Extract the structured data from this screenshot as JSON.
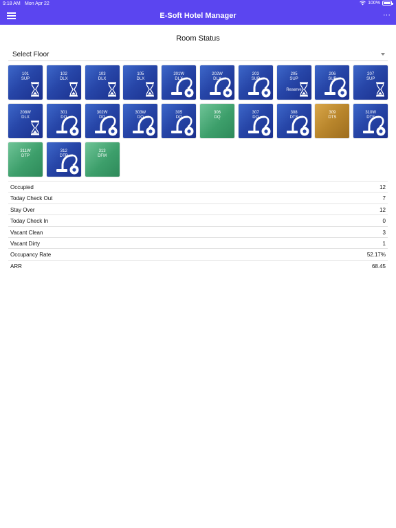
{
  "status_bar": {
    "time": "9:18 AM",
    "date": "Mon Apr 22",
    "battery": "100%"
  },
  "header": {
    "title": "E-Soft Hotel Manager",
    "more": "···"
  },
  "page": {
    "title": "Room Status",
    "floor_select_label": "Select Floor"
  },
  "colors": {
    "header": "#5b45f0",
    "occupied": "#2746a8",
    "vacant_clean": "#3d9f6b",
    "reserved": "#b9862c"
  },
  "rooms": [
    {
      "num": "101",
      "type": "SUP",
      "color": "blue",
      "icon": "hourglass-icon",
      "note": ""
    },
    {
      "num": "102",
      "type": "DLX",
      "color": "blue",
      "icon": "hourglass-icon",
      "note": ""
    },
    {
      "num": "103",
      "type": "DLX",
      "color": "blue",
      "icon": "hourglass-icon",
      "note": ""
    },
    {
      "num": "105",
      "type": "DLX",
      "color": "blue",
      "icon": "hourglass-icon",
      "note": ""
    },
    {
      "num": "201W",
      "type": "DLX",
      "color": "blue",
      "icon": "vacuum-icon",
      "note": ""
    },
    {
      "num": "202W",
      "type": "DLX",
      "color": "blue",
      "icon": "vacuum-icon",
      "note": ""
    },
    {
      "num": "203",
      "type": "SUP",
      "color": "blue",
      "icon": "vacuum-icon",
      "note": ""
    },
    {
      "num": "205",
      "type": "SUP",
      "color": "blue",
      "icon": "hourglass-icon",
      "note": "Reserve"
    },
    {
      "num": "206",
      "type": "SUP",
      "color": "blue",
      "icon": "vacuum-icon",
      "note": ""
    },
    {
      "num": "207",
      "type": "SUP",
      "color": "blue",
      "icon": "hourglass-icon",
      "note": ""
    },
    {
      "num": "208W",
      "type": "DLX",
      "color": "blue",
      "icon": "hourglass-icon",
      "note": ""
    },
    {
      "num": "301",
      "type": "DQ",
      "color": "blue",
      "icon": "vacuum-icon",
      "note": ""
    },
    {
      "num": "302W",
      "type": "DQ",
      "color": "blue",
      "icon": "vacuum-icon",
      "note": ""
    },
    {
      "num": "303W",
      "type": "DQ",
      "color": "blue",
      "icon": "vacuum-icon",
      "note": ""
    },
    {
      "num": "305",
      "type": "DQ",
      "color": "blue",
      "icon": "vacuum-icon",
      "note": ""
    },
    {
      "num": "306",
      "type": "DQ",
      "color": "green",
      "icon": "",
      "note": ""
    },
    {
      "num": "307",
      "type": "DQ",
      "color": "blue",
      "icon": "vacuum-icon",
      "note": ""
    },
    {
      "num": "308",
      "type": "DTS",
      "color": "blue",
      "icon": "vacuum-icon",
      "note": ""
    },
    {
      "num": "309",
      "type": "DTS",
      "color": "gold",
      "icon": "",
      "note": ""
    },
    {
      "num": "310W",
      "type": "DTS",
      "color": "blue",
      "icon": "vacuum-icon",
      "note": ""
    },
    {
      "num": "311W",
      "type": "DTP",
      "color": "green",
      "icon": "",
      "note": ""
    },
    {
      "num": "312",
      "type": "DTP",
      "color": "blue",
      "icon": "vacuum-icon",
      "note": ""
    },
    {
      "num": "313",
      "type": "DFM",
      "color": "green",
      "icon": "",
      "note": ""
    }
  ],
  "summary": [
    {
      "label": "Occupied",
      "value": "12"
    },
    {
      "label": "Today Check Out",
      "value": "7"
    },
    {
      "label": "Stay Over",
      "value": "12"
    },
    {
      "label": "Today Check In",
      "value": "0"
    },
    {
      "label": "Vacant Clean",
      "value": "3"
    },
    {
      "label": "Vacant Dirty",
      "value": "1"
    },
    {
      "label": "Occupancy Rate",
      "value": "52.17%"
    },
    {
      "label": "ARR",
      "value": "68.45"
    }
  ]
}
